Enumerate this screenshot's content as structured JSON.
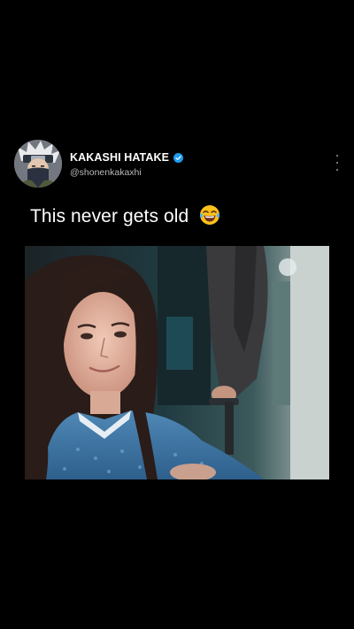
{
  "post": {
    "author": {
      "display_name": "KAKASHI HATAKE",
      "handle": "@shonenkakaxhi",
      "verified": true,
      "avatar_icon": "kakashi-avatar"
    },
    "caption": "This never gets old",
    "caption_emoji": "face-with-tears-of-joy-icon",
    "more_icon": "vertical-ellipsis-icon",
    "media": {
      "type": "video-frame",
      "description_icon": "woman-in-hospital-gown-wheelchair-image"
    }
  },
  "colors": {
    "background": "#000000",
    "text_primary": "#ffffff",
    "text_secondary": "#b9b9b9",
    "verified_blue": "#1d9bf0"
  }
}
